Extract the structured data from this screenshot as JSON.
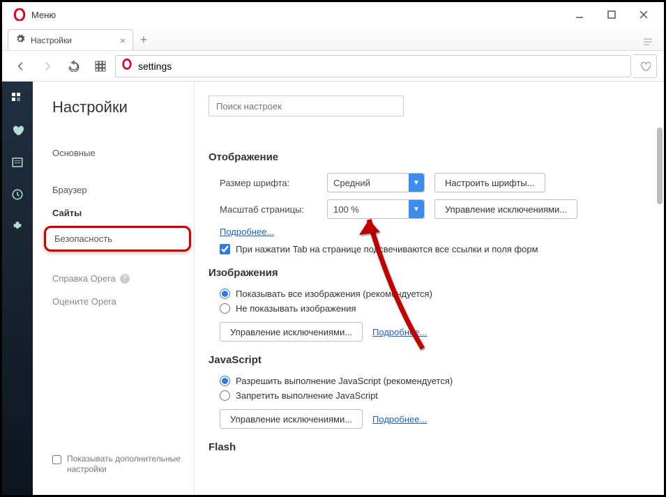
{
  "titlebar": {
    "menu": "Меню"
  },
  "tab": {
    "title": "Настройки"
  },
  "address": {
    "value": "settings"
  },
  "sidebar": {
    "heading": "Настройки",
    "items": {
      "basic": "Основные",
      "browser": "Браузер",
      "sites": "Сайты",
      "security": "Безопасность",
      "help": "Справка Opera",
      "rate": "Оцените Opera"
    },
    "advanced_label": "Показывать дополнительные настройки"
  },
  "main": {
    "search_placeholder": "Поиск настроек",
    "display": {
      "heading": "Отображение",
      "font_size_label": "Размер шрифта:",
      "font_size_value": "Средний",
      "font_btn": "Настроить шрифты...",
      "zoom_label": "Масштаб страницы:",
      "zoom_value": "100 %",
      "exceptions_btn": "Управление исключениями...",
      "more": "Подробнее...",
      "tab_highlight": "При нажатии Tab на странице подсвечиваются все ссылки и поля форм"
    },
    "images": {
      "heading": "Изображения",
      "opt_show": "Показывать все изображения (рекомендуется)",
      "opt_hide": "Не показывать изображения",
      "exceptions_btn": "Управление исключениями...",
      "more": "Подробнее..."
    },
    "js": {
      "heading": "JavaScript",
      "opt_allow": "Разрешить выполнение JavaScript (рекомендуется)",
      "opt_deny": "Запретить выполнение JavaScript",
      "exceptions_btn": "Управление исключениями...",
      "more": "Подробнее..."
    },
    "flash": {
      "heading": "Flash"
    }
  }
}
